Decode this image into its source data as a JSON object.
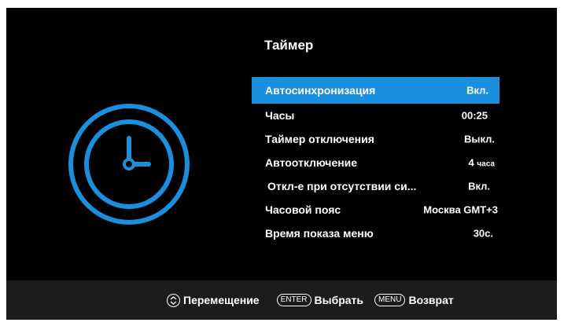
{
  "title": "Таймер",
  "accent_color": "#1a8fde",
  "clock_icon": "clock-icon",
  "menu": [
    {
      "label": "Автосинхронизация",
      "value": "Вкл.",
      "selected": true
    },
    {
      "label": "Часы",
      "value": "00:25",
      "selected": false
    },
    {
      "label": "Таймер отключения",
      "value": "Выкл.",
      "selected": false
    },
    {
      "label": "Автоотключение",
      "value": "4",
      "value_unit": "часа",
      "selected": false
    },
    {
      "label": "Откл-е при отсутствии си...",
      "value": "Вкл.",
      "selected": false
    },
    {
      "label": "Часовой пояс",
      "value": "Москва GMT+3",
      "selected": false
    },
    {
      "label": "Время показа меню",
      "value": "30с.",
      "selected": false
    }
  ],
  "hints": {
    "navigate_label": "Перемещение",
    "enter_key": "ENTER",
    "enter_label": "Выбрать",
    "menu_key": "MENU",
    "menu_label": "Возврат"
  }
}
